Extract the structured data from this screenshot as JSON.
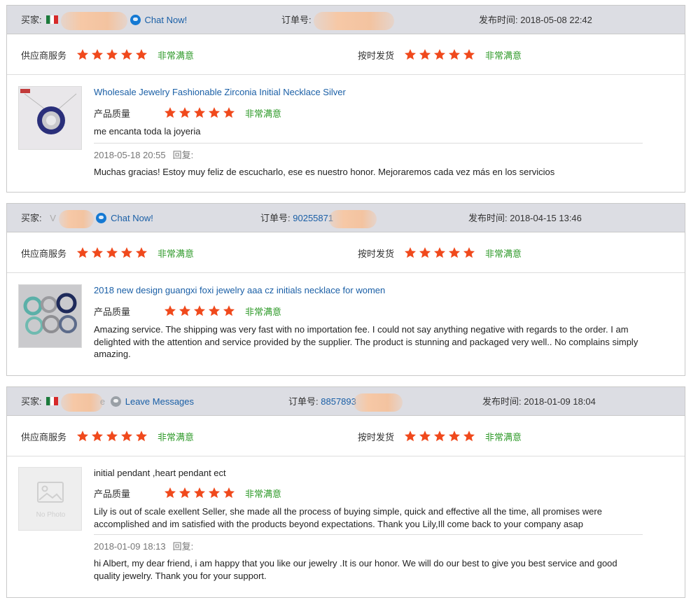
{
  "labels": {
    "buyer": "买家:",
    "order": "订单号:",
    "posted": "发布时间:",
    "supplier_service": "供应商服务",
    "on_time": "按时发货",
    "quality": "产品质量",
    "very_satisfied": "非常满意",
    "reply": "回复:"
  },
  "colors": {
    "star": "#f0491c",
    "satisfied": "#2f9a2a",
    "link": "#1a5fa6",
    "header_bg": "#dcdde3"
  },
  "reviews": [
    {
      "buyer_contact": "Chat Now!",
      "buyer_icon": "chat-icon",
      "order_no": "",
      "posted_time": "2018-05-08 22:42",
      "supplier_stars": 5,
      "shipping_stars": 5,
      "product_title": "Wholesale Jewelry Fashionable Zirconia Initial Necklace Silver",
      "quality_stars": 5,
      "comment": "me encanta toda la joyeria",
      "reply_time": "2018-05-18 20:55",
      "reply_text": "Muchas gracias! Estoy muy feliz de escucharlo, ese es nuestro honor. Mejoraremos cada vez más en los servicios"
    },
    {
      "buyer_contact": "Chat Now!",
      "buyer_icon": "chat-icon",
      "buyer_name_partial": "V",
      "order_no": "90255871",
      "posted_time": "2018-04-15 13:46",
      "supplier_stars": 5,
      "shipping_stars": 5,
      "product_title": "2018 new design guangxi foxi jewelry aaa cz initials necklace for women",
      "quality_stars": 5,
      "comment": "Amazing service. The shipping was very fast with no importation fee. I could not say anything negative with regards to the order. I am delighted with the attention and service provided by the supplier. The product is stunning and packaged very well.. No complains simply amazing."
    },
    {
      "buyer_contact": "Leave Messages",
      "buyer_icon": "message-icon",
      "buyer_name_partial": "e",
      "order_no": "8857893",
      "posted_time": "2018-01-09 18:04",
      "supplier_stars": 5,
      "shipping_stars": 5,
      "product_title": "initial pendant ,heart pendant ect",
      "no_photo": "No Photo",
      "quality_stars": 5,
      "comment": "Lily is out of scale exellent Seller, she made all the process of buying simple, quick and effective all the time, all promises were accomplished and im satisfied with the products beyond expectations. Thank you Lily,Ill come back to your company asap",
      "reply_time": "2018-01-09 18:13",
      "reply_text": "hi Albert, my dear friend, i am happy that you like our jewelry .It is our honor. We will do our best to give you best service and good quality jewelry. Thank you for your support."
    }
  ]
}
